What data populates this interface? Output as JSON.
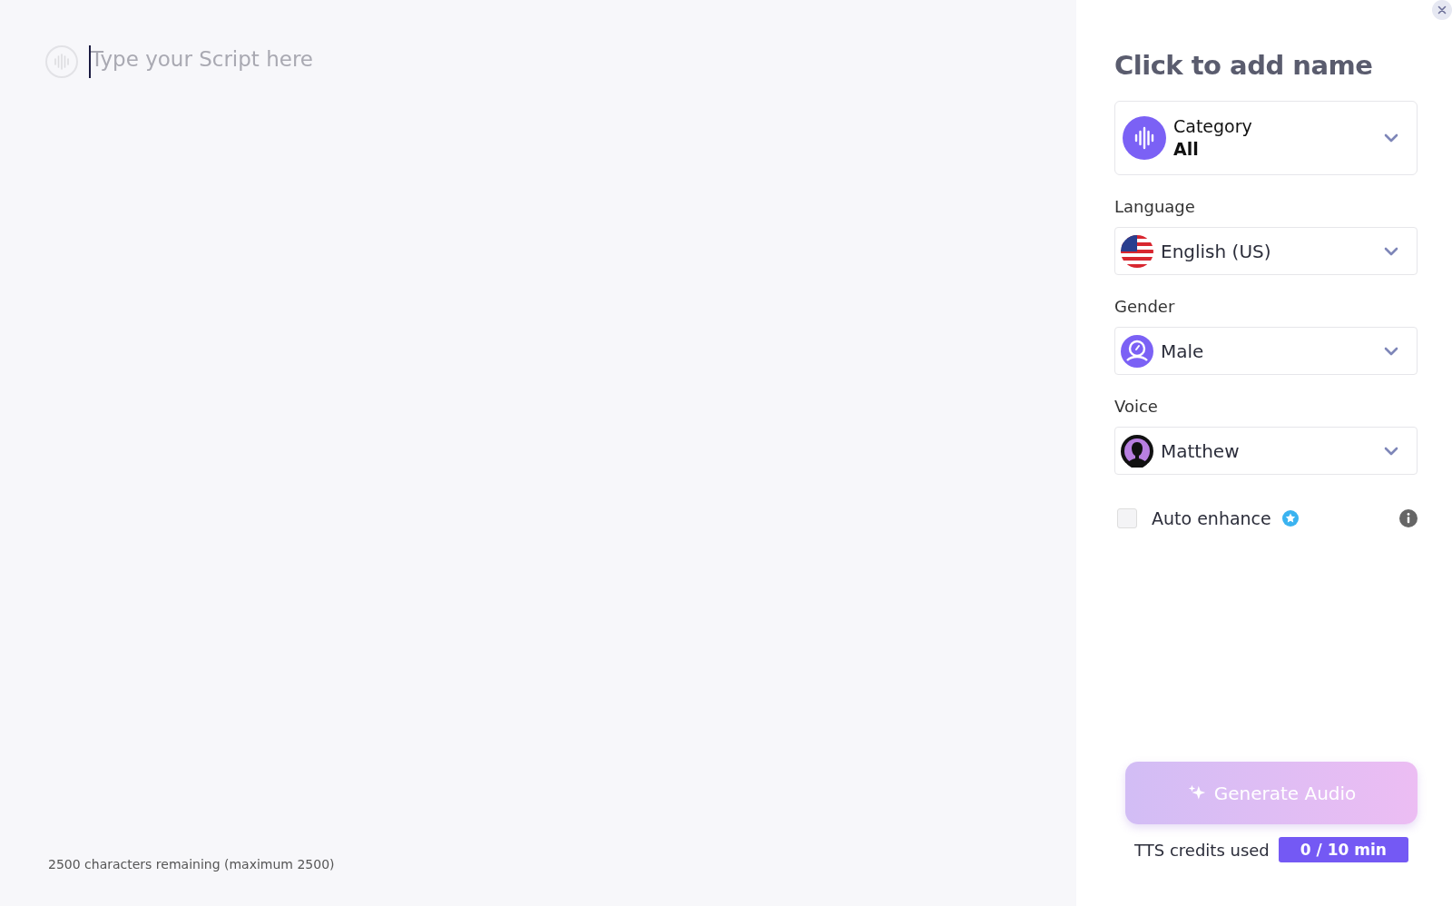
{
  "editor": {
    "placeholder": "Type your Script here",
    "counter": "2500 characters remaining (maximum 2500)"
  },
  "panel": {
    "title": "Click to add name",
    "category": {
      "label": "Category",
      "value": "All"
    },
    "selects": [
      {
        "kind": "flag",
        "label": "Language",
        "value": "English (US)"
      },
      {
        "kind": "gender",
        "label": "Gender",
        "value": "Male"
      },
      {
        "kind": "avatar",
        "label": "Voice",
        "value": "Matthew"
      }
    ],
    "auto_enhance": {
      "label": "Auto enhance",
      "checked": false
    },
    "generate": {
      "label": "Generate Audio",
      "disabled": true
    },
    "credits": {
      "label": "TTS credits used",
      "value": "0 / 10 min"
    }
  }
}
